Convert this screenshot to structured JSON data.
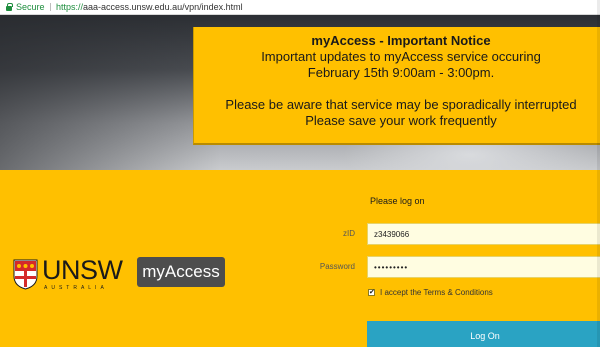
{
  "browser": {
    "secure_label": "Secure",
    "url_scheme": "https://",
    "url_rest": "aaa-access.unsw.edu.au/vpn/index.html"
  },
  "notice": {
    "title": "myAccess - Important Notice",
    "line1": "Important updates to myAccess service occuring",
    "line2": "February 15th 9:00am - 3:00pm.",
    "line3": "Please be aware that service may be sporadically interrupted",
    "line4": "Please save your work frequently"
  },
  "branding": {
    "university": "UNSW",
    "country": "AUSTRALIA",
    "app_badge": "myAccess"
  },
  "login": {
    "title": "Please log on",
    "zid_label": "zID",
    "zid_value": "z3439066",
    "password_label": "Password",
    "password_value": "•••••••••",
    "terms_checked": true,
    "terms_label": "I accept the Terms & Conditions",
    "submit_label": "Log On"
  },
  "colors": {
    "brand_yellow": "#ffc000",
    "button_blue": "#2aa3c3",
    "secure_green": "#1e8e3e"
  }
}
